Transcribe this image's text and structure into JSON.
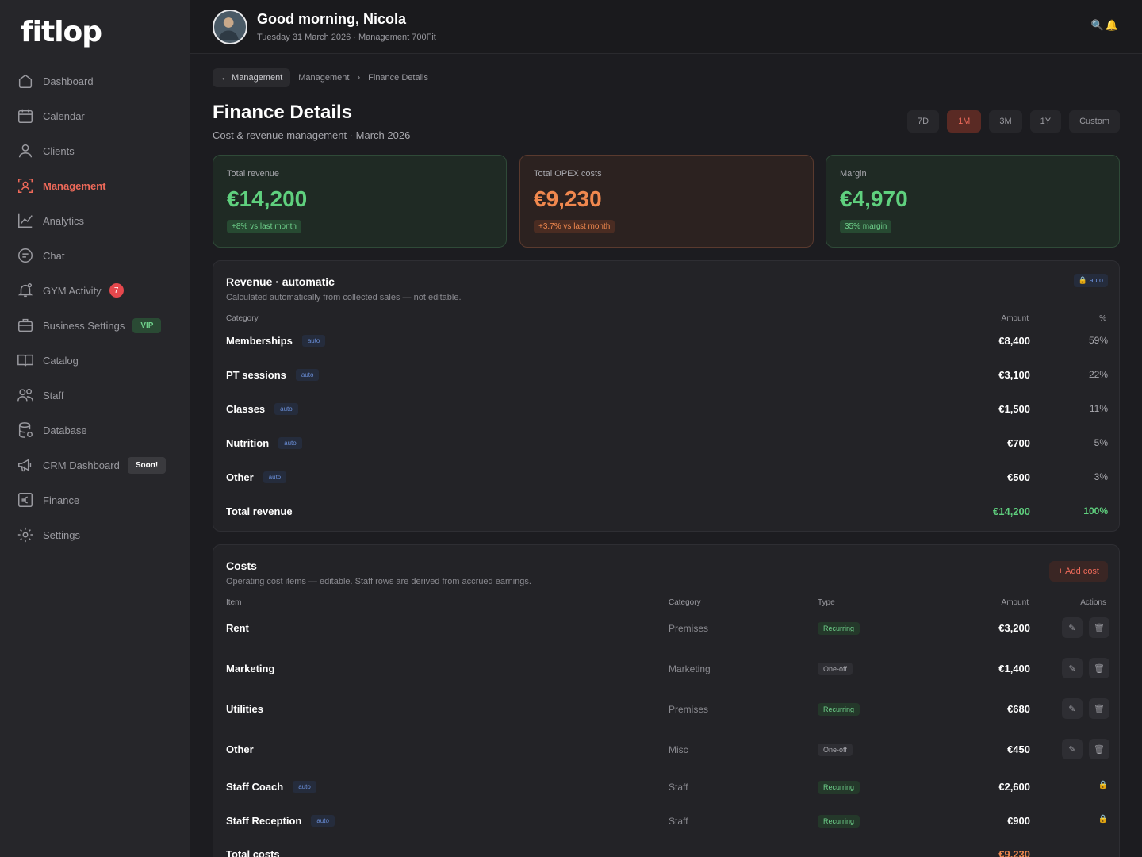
{
  "app": {
    "logo": "fitlop"
  },
  "sidebar": {
    "items": [
      {
        "label": "Dashboard",
        "icon": "home-icon"
      },
      {
        "label": "Calendar",
        "icon": "calendar-icon"
      },
      {
        "label": "Clients",
        "icon": "user-icon"
      },
      {
        "label": "Management",
        "icon": "management-icon",
        "active": true
      },
      {
        "label": "Analytics",
        "icon": "chart-icon"
      },
      {
        "label": "Chat",
        "icon": "chat-icon"
      },
      {
        "label": "GYM Activity",
        "icon": "bell-icon",
        "badge": "7"
      },
      {
        "label": "Business Settings",
        "icon": "briefcase-icon",
        "badge": "VIP"
      },
      {
        "label": "Catalog",
        "icon": "book-icon"
      },
      {
        "label": "Staff",
        "icon": "users-icon"
      },
      {
        "label": "Database",
        "icon": "database-icon"
      },
      {
        "label": "CRM Dashboard",
        "icon": "megaphone-icon",
        "badge": "Soon!"
      },
      {
        "label": "Finance",
        "icon": "euro-icon"
      },
      {
        "label": "Settings",
        "icon": "gear-icon"
      }
    ]
  },
  "header": {
    "greeting": "Good morning, Nicola",
    "subtitle": "Tuesday 31 March 2026 · Management 700Fit",
    "icons": [
      "search-icon",
      "bell-icon"
    ]
  },
  "breadcrumb": {
    "back": "← Management",
    "parent": "Management",
    "separator": "›",
    "current": "Finance Details"
  },
  "page": {
    "title": "Finance Details",
    "subtitle": "Cost & revenue management · March 2026"
  },
  "range": {
    "options": [
      "7D",
      "1M",
      "3M",
      "1Y",
      "Custom"
    ],
    "selected": "1M"
  },
  "kpis": [
    {
      "label": "Total revenue",
      "value": "€14,200",
      "delta": "+8% vs last month"
    },
    {
      "label": "Total OPEX costs",
      "value": "€9,230",
      "delta": "+3.7% vs last month"
    },
    {
      "label": "Margin",
      "value": "€4,970",
      "delta": "35% margin"
    }
  ],
  "revenue": {
    "title": "Revenue · automatic",
    "subtitle": "Calculated automatically from collected sales — not editable.",
    "lock_label": "🔒 auto",
    "headers": {
      "category": "Category",
      "amount": "Amount",
      "pct": "%"
    },
    "auto_tag": "auto",
    "rows": [
      {
        "name": "Memberships",
        "amount": "€8,400",
        "pct": "59%"
      },
      {
        "name": "PT sessions",
        "amount": "€3,100",
        "pct": "22%"
      },
      {
        "name": "Classes",
        "amount": "€1,500",
        "pct": "11%"
      },
      {
        "name": "Nutrition",
        "amount": "€700",
        "pct": "5%"
      },
      {
        "name": "Other",
        "amount": "€500",
        "pct": "3%"
      }
    ],
    "total": {
      "name": "Total revenue",
      "amount": "€14,200",
      "pct": "100%"
    }
  },
  "costs": {
    "title": "Costs",
    "subtitle": "Operating cost items — editable. Staff rows are derived from accrued earnings.",
    "add_label": "+ Add cost",
    "headers": {
      "item": "Item",
      "category": "Category",
      "type": "Type",
      "amount": "Amount",
      "actions": "Actions"
    },
    "auto_tag": "auto",
    "rows": [
      {
        "name": "Rent",
        "category": "Premises",
        "type": "Recurring",
        "amount": "€3,200"
      },
      {
        "name": "Marketing",
        "category": "Marketing",
        "type": "One-off",
        "amount": "€1,400"
      },
      {
        "name": "Utilities",
        "category": "Premises",
        "type": "Recurring",
        "amount": "€680"
      },
      {
        "name": "Other",
        "category": "Misc",
        "type": "One-off",
        "amount": "€450"
      },
      {
        "name": "Staff Coach",
        "category": "Staff",
        "type": "Recurring",
        "amount": "€2,600"
      },
      {
        "name": "Staff Reception",
        "category": "Staff",
        "type": "Recurring",
        "amount": "€900"
      }
    ],
    "total": {
      "name": "Total costs",
      "amount": "€9,230"
    }
  },
  "colors": {
    "accent": "#ef6a5a",
    "positive": "#5fd07e",
    "warning": "#f0884e",
    "auto": "#6a8ed8"
  }
}
